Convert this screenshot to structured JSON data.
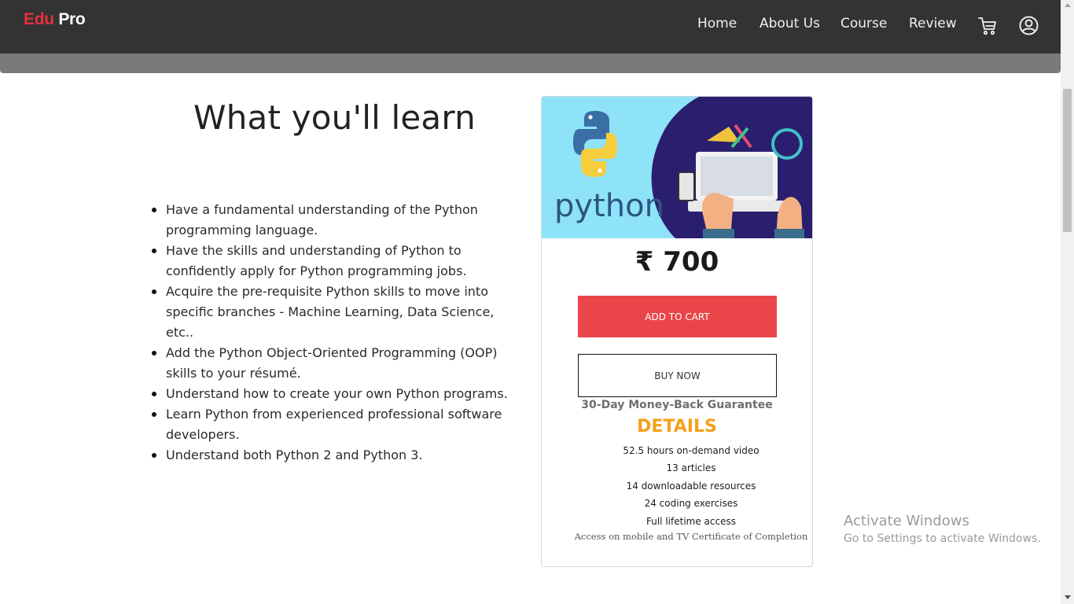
{
  "navbar": {
    "logo": {
      "part1": "Edu",
      "part2": "Pro"
    },
    "links": [
      "Home",
      "About Us",
      "Course",
      "Review"
    ],
    "icons": [
      "cart-icon",
      "user-account-icon"
    ],
    "colors": {
      "background": "#333333",
      "logo_accent": "#e8303f"
    }
  },
  "main": {
    "title": "What you'll learn",
    "items": [
      "Have a fundamental understanding of the Python programming language.",
      "Have the skills and understanding of Python to confidently apply for Python programming jobs.",
      "Acquire the pre-requisite Python skills to move into specific branches - Machine Learning, Data Science, etc..",
      "Add the Python Object-Oriented Programming (OOP) skills to your résumé.",
      "Understand how to create your own Python programs.",
      "Learn Python from experienced professional software developers.",
      "Understand both Python 2 and Python 3."
    ]
  },
  "card": {
    "image_text": "python",
    "price": "₹ 700",
    "add_to_cart": "ADD TO CART",
    "buy_now": "BUY NOW",
    "guarantee": "30-Day Money-Back Guarantee",
    "details_title": "DETAILS",
    "details": [
      "52.5 hours on-demand video",
      "13 articles",
      "14 downloadable resources",
      "24 coding exercises",
      "Full lifetime access"
    ],
    "details_note": "Access on mobile and TV Certificate of Completion",
    "colors": {
      "add_to_cart_bg": "#ea4548",
      "details_title": "#f3a11b"
    }
  },
  "watermark": {
    "title": "Activate Windows",
    "subtitle": "Go to Settings to activate Windows."
  }
}
